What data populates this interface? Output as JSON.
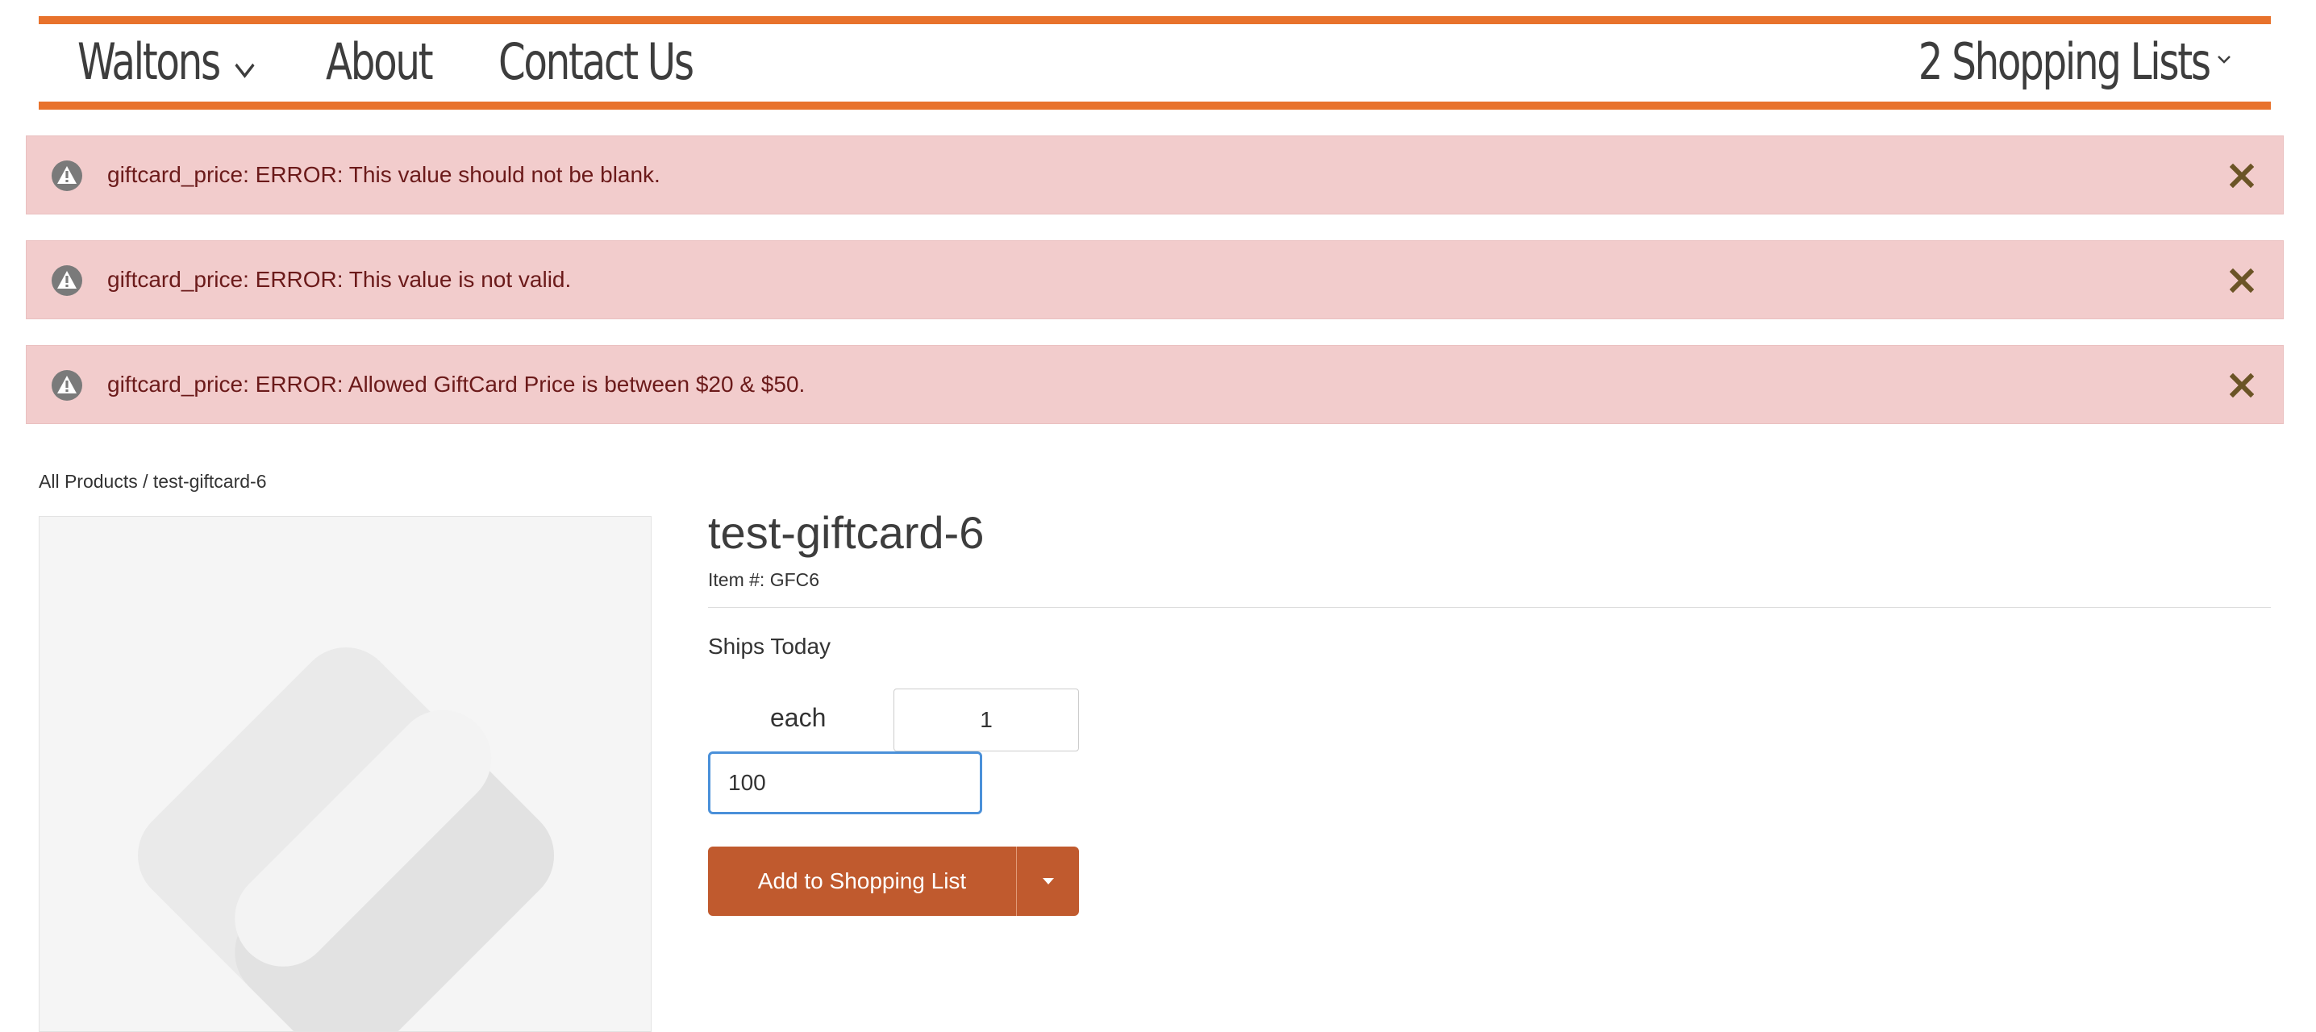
{
  "nav": {
    "brand_label": "Waltons",
    "about_label": "About",
    "contact_label": "Contact Us",
    "shopping_lists_label": "2 Shopping Lists"
  },
  "alerts": [
    {
      "text": "giftcard_price: ERROR: This value should not be blank."
    },
    {
      "text": "giftcard_price: ERROR: This value is not valid."
    },
    {
      "text": "giftcard_price: ERROR: Allowed GiftCard Price is between $20 & $50."
    }
  ],
  "breadcrumb": {
    "root_label": "All Products",
    "separator": " / ",
    "current_label": "test-giftcard-6"
  },
  "product": {
    "title": "test-giftcard-6",
    "item_number": "Item #: GFC6",
    "availability": "Ships Today",
    "unit_label": "each",
    "quantity_value": "1",
    "price_value": "100",
    "add_button_label": "Add to Shopping List"
  },
  "colors": {
    "accent": "#e8722c",
    "button": "#c05a2e",
    "alert_bg": "#f2cccc",
    "alert_text": "#6b1a1a"
  },
  "icons": {
    "brand_dropdown": "chevron-down-icon",
    "lists_dropdown": "chevron-down-icon",
    "alert": "warning-icon",
    "alert_close": "close-icon",
    "button_dropdown": "caret-down-icon",
    "product_placeholder": "image-placeholder-icon"
  }
}
